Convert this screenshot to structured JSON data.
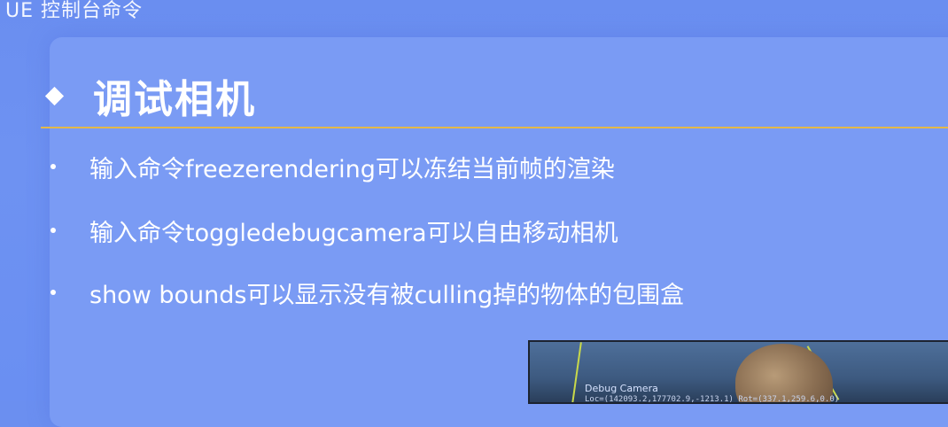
{
  "header": {
    "title": "UE 控制台命令"
  },
  "section": {
    "title": "调试相机"
  },
  "bullets": [
    {
      "text": "输入命令freezerendering可以冻结当前帧的渲染"
    },
    {
      "text": "输入命令toggledebugcamera可以自由移动相机"
    },
    {
      "text": "show bounds可以显示没有被culling掉的物体的包围盒"
    }
  ],
  "debug_view": {
    "label": "Debug Camera",
    "readout": "Loc=(142093.2,177702.9,-1213.1) Rot=(337.1,259.6,0.0)"
  },
  "colors": {
    "background": "#6b8ff0",
    "panel": "#7a9bf4",
    "rule": "#e3b84a",
    "text": "#ffffff"
  }
}
